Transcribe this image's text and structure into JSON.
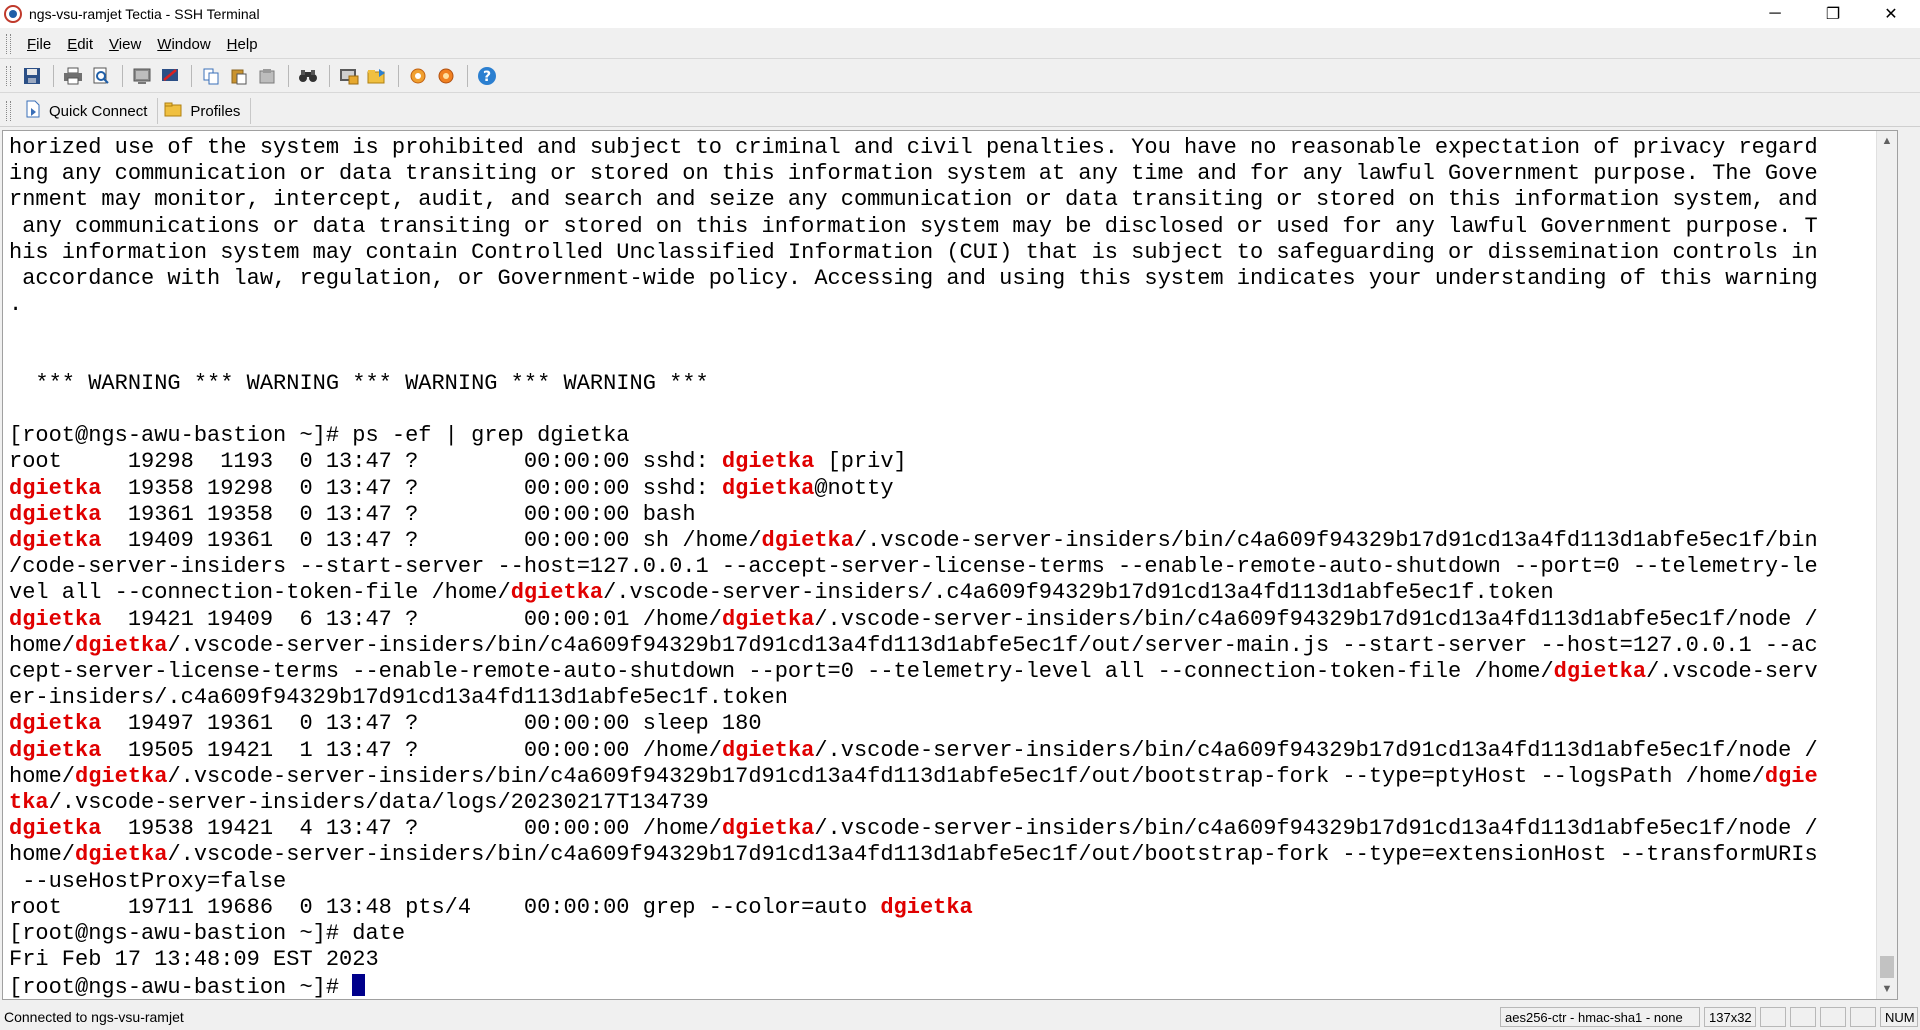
{
  "window": {
    "title": "ngs-vsu-ramjet Tectia - SSH Terminal",
    "controls": {
      "minimize": "─",
      "restore": "❐",
      "close": "✕"
    }
  },
  "menu": [
    {
      "label": "File",
      "mnemonic": "F",
      "rest": "ile"
    },
    {
      "label": "Edit",
      "mnemonic": "E",
      "rest": "dit"
    },
    {
      "label": "View",
      "mnemonic": "V",
      "rest": "iew"
    },
    {
      "label": "Window",
      "mnemonic": "W",
      "rest": "indow"
    },
    {
      "label": "Help",
      "mnemonic": "H",
      "rest": "elp"
    }
  ],
  "toolbar_icons": [
    "save-icon",
    "print-icon",
    "print-preview-icon",
    "new-terminal-icon",
    "disconnect-icon",
    "copy-icon",
    "paste-icon",
    "paste-special-icon",
    "find-icon",
    "file-transfer-icon",
    "new-file-transfer-icon",
    "settings-icon",
    "profile-settings-icon",
    "help-icon"
  ],
  "quickbar": {
    "quick_connect": "Quick Connect",
    "profiles": "Profiles"
  },
  "terminal": {
    "highlight_color": "#e00000",
    "cursor_color": "#00008b",
    "lines": [
      [
        [
          "horized use of the system is prohibited and subject to criminal and civil penalties. You have no reasonable expectation of privacy regard",
          0
        ]
      ],
      [
        [
          "ing any communication or data transiting or stored on this information system at any time and for any lawful Government purpose. The Gove",
          0
        ]
      ],
      [
        [
          "rnment may monitor, intercept, audit, and search and seize any communication or data transiting or stored on this information system, and",
          0
        ]
      ],
      [
        [
          " any communications or data transiting or stored on this information system may be disclosed or used for any lawful Government purpose. T",
          0
        ]
      ],
      [
        [
          "his information system may contain Controlled Unclassified Information (CUI) that is subject to safeguarding or dissemination controls in",
          0
        ]
      ],
      [
        [
          " accordance with law, regulation, or Government-wide policy. Accessing and using this system indicates your understanding of this warning",
          0
        ]
      ],
      [
        [
          ".",
          0
        ]
      ],
      [
        [
          "",
          0
        ]
      ],
      [
        [
          "",
          0
        ]
      ],
      [
        [
          "  *** WARNING *** WARNING *** WARNING *** WARNING ***",
          0
        ]
      ],
      [
        [
          "",
          0
        ]
      ],
      [
        [
          "[root@ngs-awu-bastion ~]# ps -ef | grep dgietka",
          0
        ]
      ],
      [
        [
          "root     19298  1193  0 13:47 ?        00:00:00 sshd: ",
          0
        ],
        [
          "dgietka",
          1
        ],
        [
          " [priv]",
          0
        ]
      ],
      [
        [
          "dgietka",
          1
        ],
        [
          "  19358 19298  0 13:47 ?        00:00:00 sshd: ",
          0
        ],
        [
          "dgietka",
          1
        ],
        [
          "@notty",
          0
        ]
      ],
      [
        [
          "dgietka",
          1
        ],
        [
          "  19361 19358  0 13:47 ?        00:00:00 bash",
          0
        ]
      ],
      [
        [
          "dgietka",
          1
        ],
        [
          "  19409 19361  0 13:47 ?        00:00:00 sh /home/",
          0
        ],
        [
          "dgietka",
          1
        ],
        [
          "/.vscode-server-insiders/bin/c4a609f94329b17d91cd13a4fd113d1abfe5ec1f/bin",
          0
        ]
      ],
      [
        [
          "/code-server-insiders --start-server --host=127.0.0.1 --accept-server-license-terms --enable-remote-auto-shutdown --port=0 --telemetry-le",
          0
        ]
      ],
      [
        [
          "vel all --connection-token-file /home/",
          0
        ],
        [
          "dgietka",
          1
        ],
        [
          "/.vscode-server-insiders/.c4a609f94329b17d91cd13a4fd113d1abfe5ec1f.token",
          0
        ]
      ],
      [
        [
          "dgietka",
          1
        ],
        [
          "  19421 19409  6 13:47 ?        00:00:01 /home/",
          0
        ],
        [
          "dgietka",
          1
        ],
        [
          "/.vscode-server-insiders/bin/c4a609f94329b17d91cd13a4fd113d1abfe5ec1f/node /",
          0
        ]
      ],
      [
        [
          "home/",
          0
        ],
        [
          "dgietka",
          1
        ],
        [
          "/.vscode-server-insiders/bin/c4a609f94329b17d91cd13a4fd113d1abfe5ec1f/out/server-main.js --start-server --host=127.0.0.1 --ac",
          0
        ]
      ],
      [
        [
          "cept-server-license-terms --enable-remote-auto-shutdown --port=0 --telemetry-level all --connection-token-file /home/",
          0
        ],
        [
          "dgietka",
          1
        ],
        [
          "/.vscode-serv",
          0
        ]
      ],
      [
        [
          "er-insiders/.c4a609f94329b17d91cd13a4fd113d1abfe5ec1f.token",
          0
        ]
      ],
      [
        [
          "dgietka",
          1
        ],
        [
          "  19497 19361  0 13:47 ?        00:00:00 sleep 180",
          0
        ]
      ],
      [
        [
          "dgietka",
          1
        ],
        [
          "  19505 19421  1 13:47 ?        00:00:00 /home/",
          0
        ],
        [
          "dgietka",
          1
        ],
        [
          "/.vscode-server-insiders/bin/c4a609f94329b17d91cd13a4fd113d1abfe5ec1f/node /",
          0
        ]
      ],
      [
        [
          "home/",
          0
        ],
        [
          "dgietka",
          1
        ],
        [
          "/.vscode-server-insiders/bin/c4a609f94329b17d91cd13a4fd113d1abfe5ec1f/out/bootstrap-fork --type=ptyHost --logsPath /home/",
          0
        ],
        [
          "dgie",
          1
        ]
      ],
      [
        [
          "tka",
          1
        ],
        [
          "/.vscode-server-insiders/data/logs/20230217T134739",
          0
        ]
      ],
      [
        [
          "dgietka",
          1
        ],
        [
          "  19538 19421  4 13:47 ?        00:00:00 /home/",
          0
        ],
        [
          "dgietka",
          1
        ],
        [
          "/.vscode-server-insiders/bin/c4a609f94329b17d91cd13a4fd113d1abfe5ec1f/node /",
          0
        ]
      ],
      [
        [
          "home/",
          0
        ],
        [
          "dgietka",
          1
        ],
        [
          "/.vscode-server-insiders/bin/c4a609f94329b17d91cd13a4fd113d1abfe5ec1f/out/bootstrap-fork --type=extensionHost --transformURIs",
          0
        ]
      ],
      [
        [
          " --useHostProxy=false",
          0
        ]
      ],
      [
        [
          "root     19711 19686  0 13:48 pts/4    00:00:00 grep --color=auto ",
          0
        ],
        [
          "dgietka",
          1
        ]
      ],
      [
        [
          "[root@ngs-awu-bastion ~]# date",
          0
        ]
      ],
      [
        [
          "Fri Feb 17 13:48:09 EST 2023",
          0
        ]
      ],
      [
        [
          "[root@ngs-awu-bastion ~]# ",
          0
        ]
      ]
    ]
  },
  "status": {
    "connection": "Connected to ngs-vsu-ramjet",
    "cipher": "aes256-ctr - hmac-sha1 - none",
    "size": "137x32",
    "num": "NUM"
  }
}
